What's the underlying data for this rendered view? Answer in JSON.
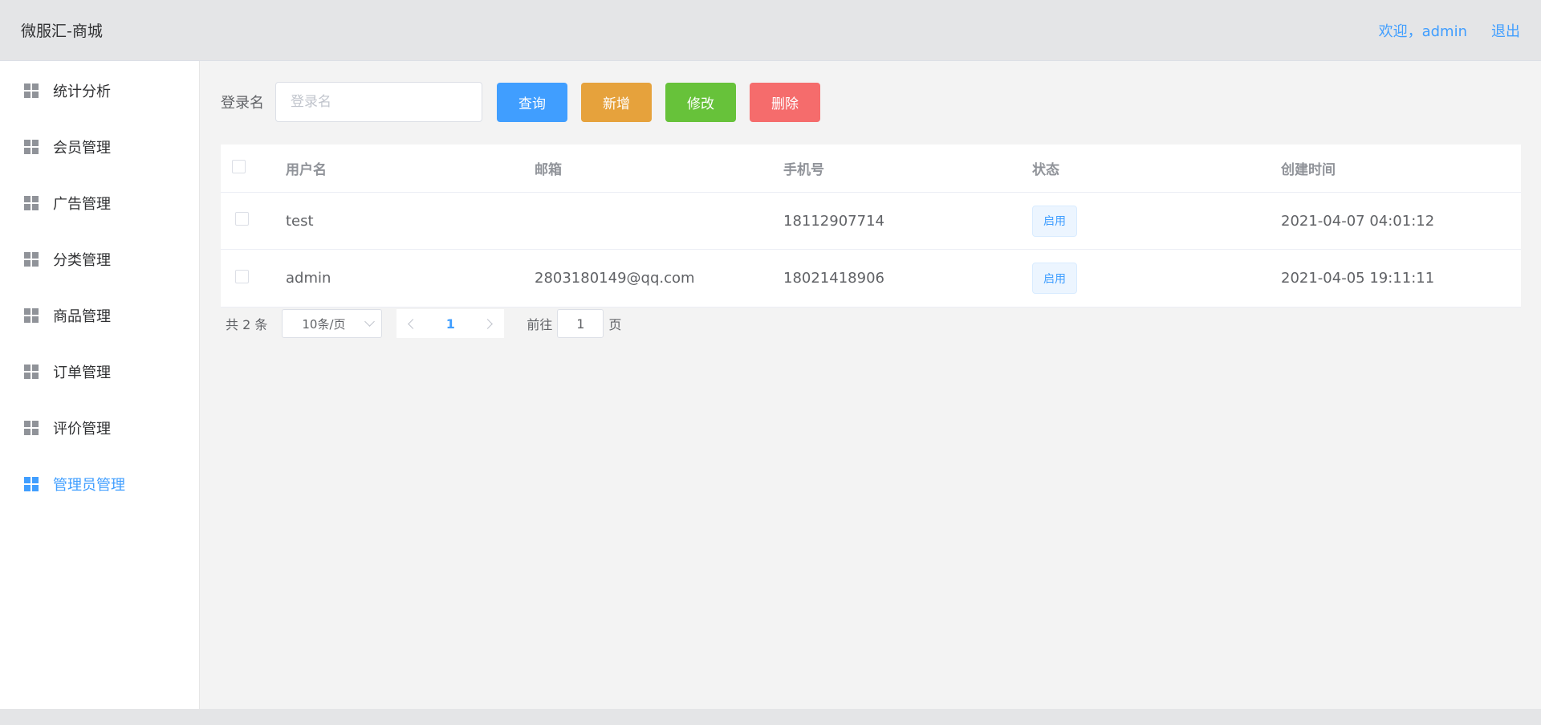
{
  "header": {
    "brand": "微服汇-商城",
    "welcome": "欢迎，admin",
    "logout": "退出"
  },
  "sidebar": {
    "items": [
      {
        "label": "统计分析",
        "icon": "grid-icon",
        "active": false
      },
      {
        "label": "会员管理",
        "icon": "grid-icon",
        "active": false
      },
      {
        "label": "广告管理",
        "icon": "grid-icon",
        "active": false
      },
      {
        "label": "分类管理",
        "icon": "grid-icon",
        "active": false
      },
      {
        "label": "商品管理",
        "icon": "grid-icon",
        "active": false
      },
      {
        "label": "订单管理",
        "icon": "grid-icon",
        "active": false
      },
      {
        "label": "评价管理",
        "icon": "grid-icon",
        "active": false
      },
      {
        "label": "管理员管理",
        "icon": "grid-icon",
        "active": true
      }
    ]
  },
  "toolbar": {
    "login_label": "登录名",
    "login_placeholder": "登录名",
    "query_label": "查询",
    "add_label": "新增",
    "edit_label": "修改",
    "delete_label": "删除"
  },
  "table": {
    "columns": [
      "用户名",
      "邮箱",
      "手机号",
      "状态",
      "创建时间"
    ],
    "rows": [
      {
        "username": "test",
        "email": "",
        "phone": "18112907714",
        "status": "启用",
        "created": "2021-04-07 04:01:12"
      },
      {
        "username": "admin",
        "email": "2803180149@qq.com",
        "phone": "18021418906",
        "status": "启用",
        "created": "2021-04-05 19:11:11"
      }
    ]
  },
  "pagination": {
    "total": "共 2 条",
    "page_size": "10条/页",
    "current_page": "1",
    "goto_prefix": "前往",
    "goto_value": "1",
    "goto_suffix": "页"
  },
  "colors": {
    "primary": "#409eff",
    "warning": "#e6a23c",
    "success": "#67c23a",
    "danger": "#f56c6c"
  }
}
